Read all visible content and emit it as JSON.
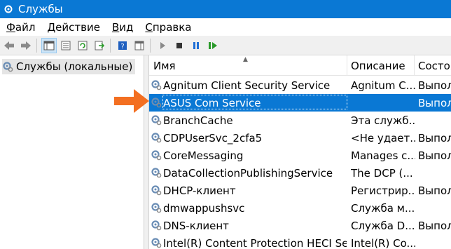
{
  "window": {
    "title": "Службы"
  },
  "menu": [
    {
      "label": "Файл",
      "underline": "Ф",
      "rest": "айл"
    },
    {
      "label": "Действие",
      "underline": "Д",
      "rest": "ействие"
    },
    {
      "label": "Вид",
      "underline": "В",
      "rest": "ид"
    },
    {
      "label": "Справка",
      "underline": "С",
      "rest": "правка"
    }
  ],
  "toolbar": {
    "buttons": [
      "back-icon",
      "forward-icon",
      "console-tree-icon",
      "properties-icon",
      "refresh-icon",
      "export-icon",
      "help-icon",
      "action-pane-icon",
      "play-icon",
      "stop-icon",
      "pause-icon",
      "restart-icon"
    ]
  },
  "left": {
    "item": "Службы (локальные)"
  },
  "table": {
    "columns": {
      "name": "Имя",
      "desc": "Описание",
      "status": "Состоя"
    },
    "rows": [
      {
        "name": "Agnitum Client Security Service",
        "desc": "Agnitum C...",
        "status": "Выпол"
      },
      {
        "name": "ASUS Com Service",
        "desc": "",
        "status": "Выпол",
        "selected": true
      },
      {
        "name": "BranchCache",
        "desc": "Эта служб...",
        "status": ""
      },
      {
        "name": "CDPUserSvc_2cfa5",
        "desc": "<Не удает...",
        "status": "Выпол"
      },
      {
        "name": "CoreMessaging",
        "desc": "Manages c...",
        "status": "Выпол"
      },
      {
        "name": "DataCollectionPublishingService",
        "desc": "The DCP (...",
        "status": ""
      },
      {
        "name": "DHCP-клиент",
        "desc": "Регистрир...",
        "status": "Выпол"
      },
      {
        "name": "dmwappushsvc",
        "desc": "Служба м...",
        "status": ""
      },
      {
        "name": "DNS-клиент",
        "desc": "Служба D...",
        "status": "Выпол"
      },
      {
        "name": "Intel(R) Content Protection HECI Ser...",
        "desc": "Intel(R) Co...",
        "status": ""
      }
    ]
  },
  "colors": {
    "accent": "#0a78d4",
    "arrow": "#f36f21"
  }
}
